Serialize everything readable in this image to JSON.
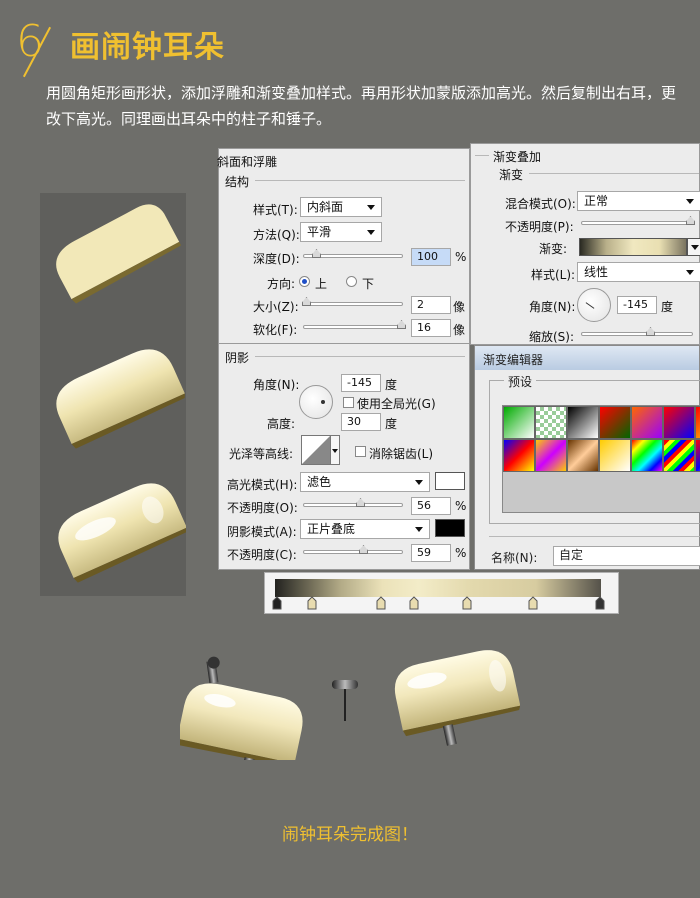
{
  "header": {
    "number": "6",
    "title": "画闹钟耳朵",
    "description": "用圆角矩形画形状，添加浮雕和渐变叠加样式。再用形状加蒙版添加高光。然后复制出右耳，更改下高光。同理画出耳朵中的柱子和锤子。"
  },
  "bevel": {
    "title": "斜面和浮雕",
    "structure_title": "结构",
    "style_label": "样式(T):",
    "style_value": "内斜面",
    "method_label": "方法(Q):",
    "method_value": "平滑",
    "depth_label": "深度(D):",
    "depth_value": "100",
    "depth_unit": "%",
    "direction_label": "方向:",
    "dir_up": "上",
    "dir_down": "下",
    "size_label": "大小(Z):",
    "size_value": "2",
    "size_unit": "像",
    "soften_label": "软化(F):",
    "soften_value": "16",
    "soften_unit": "像",
    "shading_title": "阴影",
    "angle_label": "角度(N):",
    "angle_value": "-145",
    "angle_unit": "度",
    "global_light": "使用全局光(G)",
    "altitude_label": "高度:",
    "altitude_value": "30",
    "altitude_unit": "度",
    "gloss_label": "光泽等高线:",
    "antialias": "消除锯齿(L)",
    "highlight_mode_label": "高光模式(H):",
    "highlight_mode_value": "滤色",
    "highlight_color": "#ffffff",
    "opacity1_label": "不透明度(O):",
    "opacity1_value": "56",
    "opacity_unit": "%",
    "shadow_mode_label": "阴影模式(A):",
    "shadow_mode_value": "正片叠底",
    "shadow_color": "#000000",
    "opacity2_label": "不透明度(C):",
    "opacity2_value": "59"
  },
  "gradient_overlay": {
    "title": "渐变叠加",
    "sub_title": "渐变",
    "blend_label": "混合模式(O):",
    "blend_value": "正常",
    "opacity_label": "不透明度(P):",
    "gradient_label": "渐变:",
    "style_label": "样式(L):",
    "style_value": "线性",
    "angle_label": "角度(N):",
    "angle_value": "-145",
    "angle_unit": "度",
    "scale_label": "缩放(S):"
  },
  "gradient_editor": {
    "title": "渐变编辑器",
    "presets_label": "预设",
    "name_label": "名称(N):",
    "name_value": "自定"
  },
  "caption": "闹钟耳朵完成图！",
  "colors": {
    "accent": "#f0c030",
    "background": "#6e6e6a",
    "cream": "#f2e8b8"
  }
}
